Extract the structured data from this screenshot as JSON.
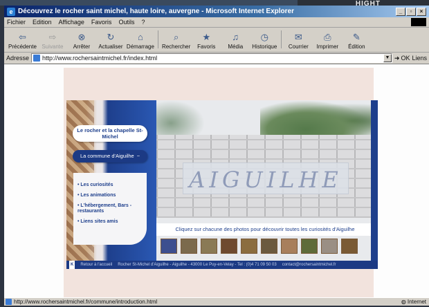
{
  "window": {
    "title": "Découvrez le rocher saint michel, haute loire, auvergne - Microsoft Internet Explorer",
    "corner_brand": "HIGHT"
  },
  "menu": [
    "Fichier",
    "Edition",
    "Affichage",
    "Favoris",
    "Outils",
    "?"
  ],
  "toolbar": {
    "buttons": [
      {
        "label": "Précédente",
        "icon": "back-arrow-icon",
        "glyph": "⇦",
        "disabled": false
      },
      {
        "label": "Suivante",
        "icon": "forward-arrow-icon",
        "glyph": "⇨",
        "disabled": true
      },
      {
        "label": "Arrêter",
        "icon": "stop-icon",
        "glyph": "⊗",
        "disabled": false
      },
      {
        "label": "Actualiser",
        "icon": "refresh-icon",
        "glyph": "↻",
        "disabled": false
      },
      {
        "label": "Démarrage",
        "icon": "home-icon",
        "glyph": "⌂",
        "disabled": false
      },
      {
        "label": "Rechercher",
        "icon": "search-icon",
        "glyph": "⌕",
        "disabled": false
      },
      {
        "label": "Favoris",
        "icon": "favorites-icon",
        "glyph": "★",
        "disabled": false
      },
      {
        "label": "Média",
        "icon": "media-icon",
        "glyph": "♫",
        "disabled": false
      },
      {
        "label": "Historique",
        "icon": "history-icon",
        "glyph": "◷",
        "disabled": false
      },
      {
        "label": "Courrier",
        "icon": "mail-icon",
        "glyph": "✉",
        "disabled": false
      },
      {
        "label": "Imprimer",
        "icon": "print-icon",
        "glyph": "⎙",
        "disabled": false
      },
      {
        "label": "Édition",
        "icon": "edit-icon",
        "glyph": "✎",
        "disabled": false
      }
    ]
  },
  "address": {
    "label": "Adresse",
    "url": "http://www.rochersaintmichel.fr/index.html",
    "go_label": "OK",
    "links_label": "Liens"
  },
  "site": {
    "pill_primary": "Le rocher et la chapelle St-Michel",
    "pill_secondary": "La commune d'Aiguilhe",
    "links": [
      "Les curiosités",
      "Les animations",
      "L'hébergement, Bars - restaurants",
      "Liens sites amis"
    ],
    "title": "AIGUILHE",
    "caption": "Cliquez sur chacune des photos pour découvrir toutes les curiosités d'Aiguilhe",
    "footer_k": "K",
    "footer_text": "Retour à l'accueil",
    "footer_address": "Rocher St-Michel d'Aiguilhe - Aiguilhe - 43000 Le Puy-en-Velay - Tel : (0)4 71 09 50 03",
    "footer_email": "contact@rochersaintmichel.fr",
    "thumb_colors": [
      "#3d4f8f",
      "#7b6a4d",
      "#8a7a55",
      "#6e4a2f",
      "#8b6d3f",
      "#6b5a3f",
      "#a87f5c",
      "#5e6b3a",
      "#9a8f84",
      "#7a5a34"
    ]
  },
  "status": {
    "text": "http://www.rochersaintmichel.fr/commune/introduction.html",
    "zone": "Internet"
  },
  "colors": {
    "accent": "#1e3f8c",
    "page_background": "#f2e3dd"
  }
}
